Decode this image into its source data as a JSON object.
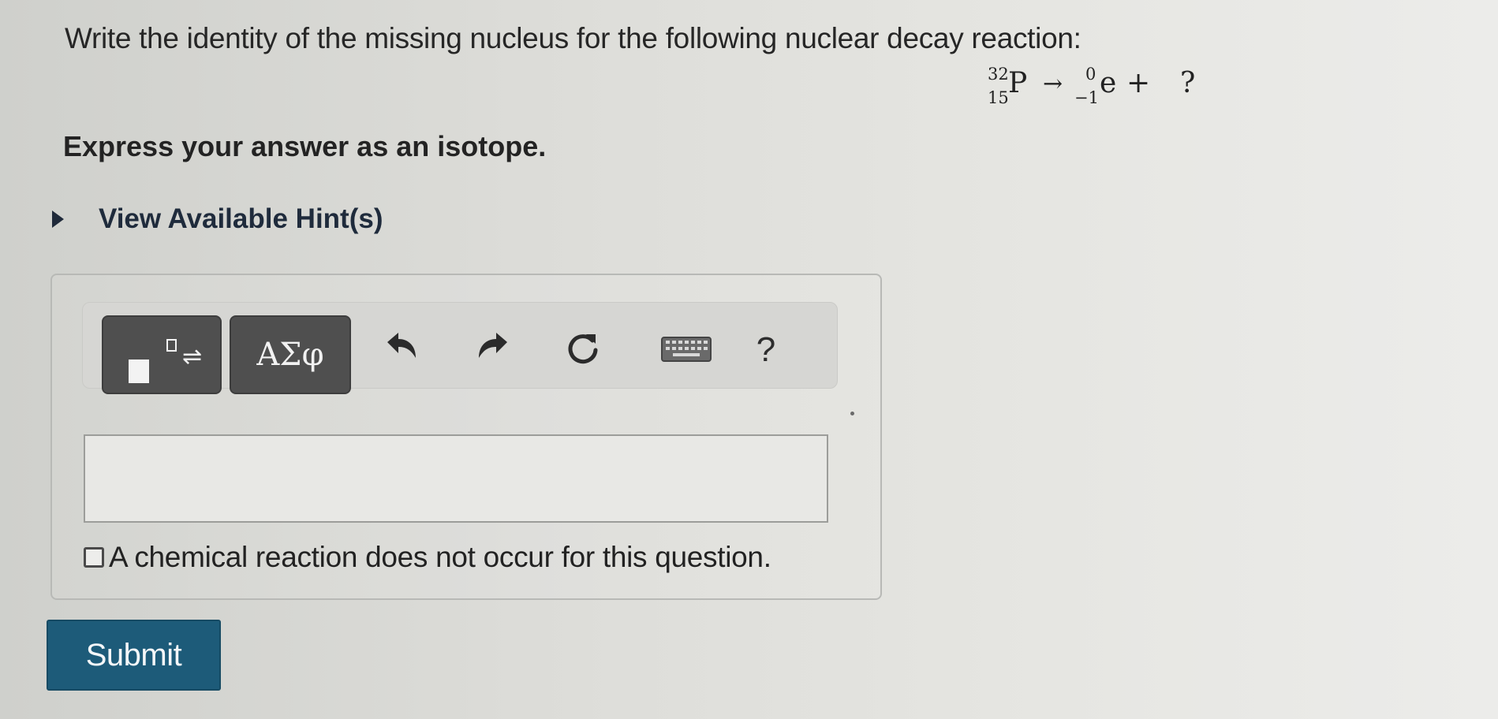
{
  "question": {
    "prompt": "Write the identity of the missing nucleus for the following nuclear decay reaction:",
    "equation": {
      "reactant_mass": "32",
      "reactant_atomic": "15",
      "reactant_symbol": "P",
      "arrow": "→",
      "product_mass": "0",
      "product_atomic": "−1",
      "product_symbol": "e",
      "plus": "+",
      "unknown": "?"
    },
    "instruction": "Express your answer as an isotope."
  },
  "hints": {
    "label": "View Available Hint(s)"
  },
  "toolbar": {
    "greek_label": "ΑΣφ",
    "help_label": "?",
    "template_arrows": "⇌"
  },
  "answer": {
    "value": "",
    "placeholder": ""
  },
  "no_reaction": {
    "label": "A chemical reaction does not occur for this question.",
    "checked": false
  },
  "submit": {
    "label": "Submit"
  },
  "colors": {
    "submit_bg": "#1d5b79",
    "toolbar_dark": "#4f4f4f"
  }
}
